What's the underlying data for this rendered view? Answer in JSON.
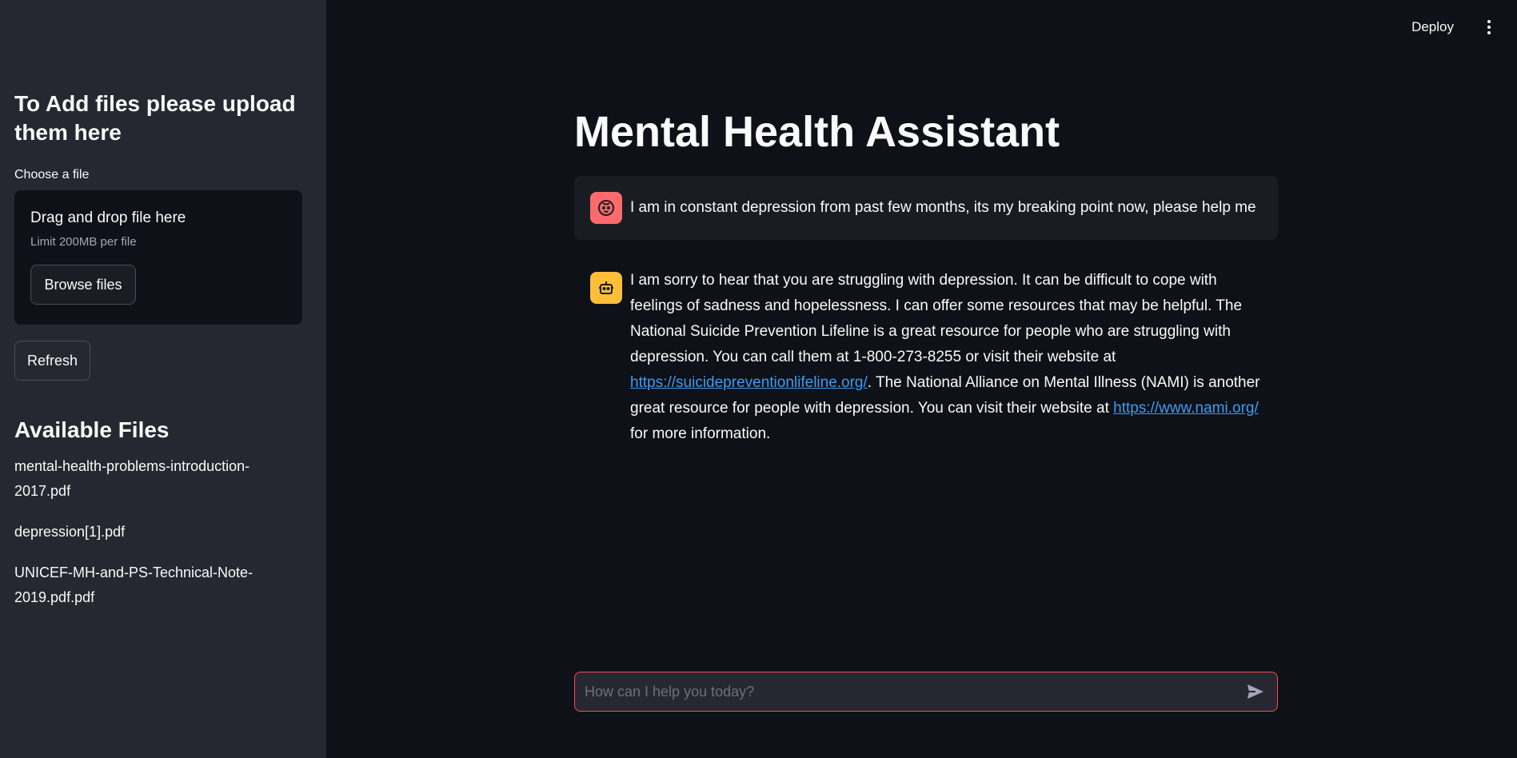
{
  "header": {
    "deploy_label": "Deploy",
    "menu_icon": "kebab-menu-icon"
  },
  "sidebar": {
    "upload_heading": "To Add files please upload them here",
    "uploader_label": "Choose a file",
    "dropzone_title": "Drag and drop file here",
    "dropzone_limit": "Limit 200MB per file",
    "browse_label": "Browse files",
    "refresh_label": "Refresh",
    "files_heading": "Available Files",
    "files": [
      "mental-health-problems-introduction-2017.pdf",
      "depression[1].pdf",
      "UNICEF-MH-and-PS-Technical-Note-2019.pdf.pdf"
    ]
  },
  "main": {
    "title": "Mental Health Assistant",
    "messages": [
      {
        "role": "user",
        "icon": "user-face-icon",
        "text": "I am in constant depression from past few months, its my breaking point now, please help me"
      },
      {
        "role": "assistant",
        "icon": "robot-icon",
        "text_1": "I am sorry to hear that you are struggling with depression. It can be difficult to cope with feelings of sadness and hopelessness. I can offer some resources that may be helpful. The National Suicide Prevention Lifeline is a great resource for people who are struggling with depression. You can call them at 1-800-273-8255 or visit their website at ",
        "link_1": "https://suicidepreventionlifeline.org/",
        "text_2": ". The National Alliance on Mental Illness (NAMI) is another great resource for people with depression. You can visit their website at ",
        "link_2": "https://www.nami.org/",
        "text_3": " for more information."
      }
    ]
  },
  "chat_input": {
    "placeholder": "How can I help you today?",
    "send_icon": "send-icon"
  },
  "colors": {
    "background": "#0e1117",
    "sidebar": "#262730",
    "accent": "#ff4b4b",
    "link": "#3d9df5",
    "user_avatar": "#ff6b6b",
    "bot_avatar": "#fdbe3a"
  }
}
